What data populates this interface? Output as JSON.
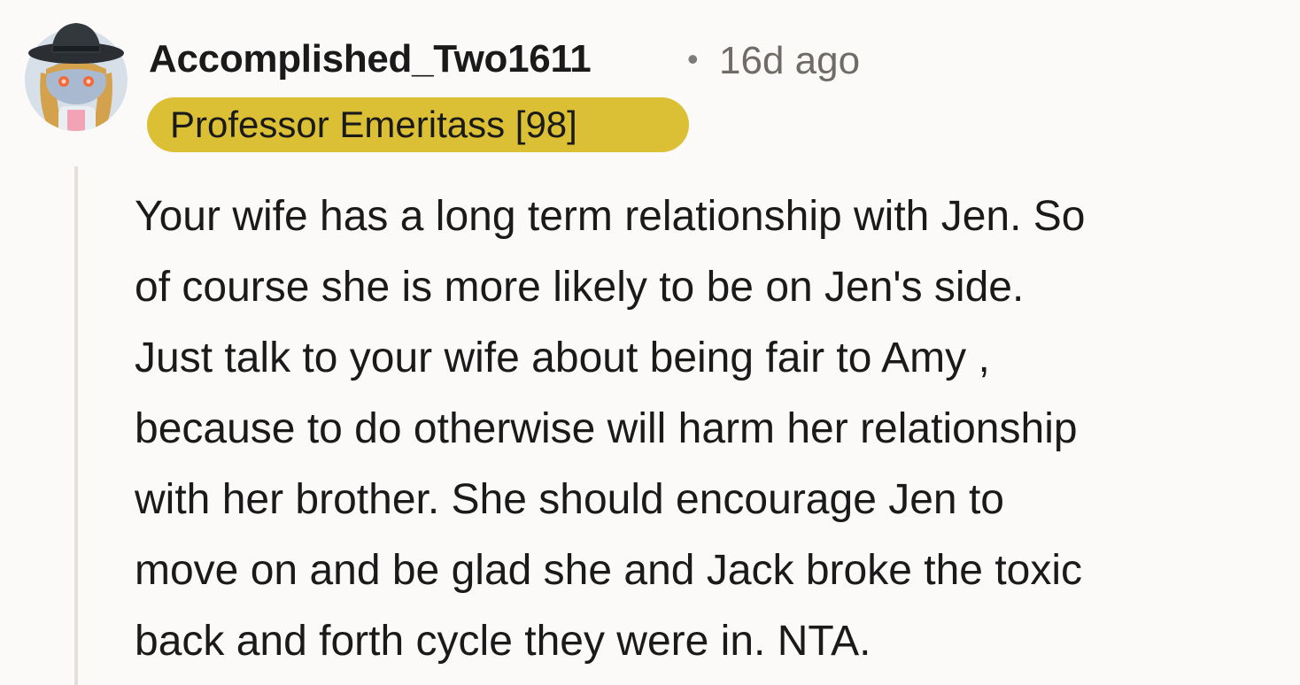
{
  "comment": {
    "author": "Accomplished_Two1611",
    "separator": "•",
    "timestamp": "16d ago",
    "flair": "Professor Emeritass [98]",
    "avatar_icon": "snoo-avatar-icon",
    "colors": {
      "flair_background": "#dbbf35",
      "page_background": "#fbfaf9",
      "thread_line": "#e4dfda",
      "timestamp": "#6f6b66"
    },
    "body_lines": [
      "Your wife has a long term relationship with Jen. So",
      "of course she is more likely to be on Jen's side.",
      "Just talk to your wife about being fair to Amy ,",
      "because to do otherwise will harm her relationship",
      "with her brother. She should encourage Jen to",
      "move on and be glad she and Jack broke the toxic",
      "back and forth cycle they were in. NTA."
    ]
  }
}
